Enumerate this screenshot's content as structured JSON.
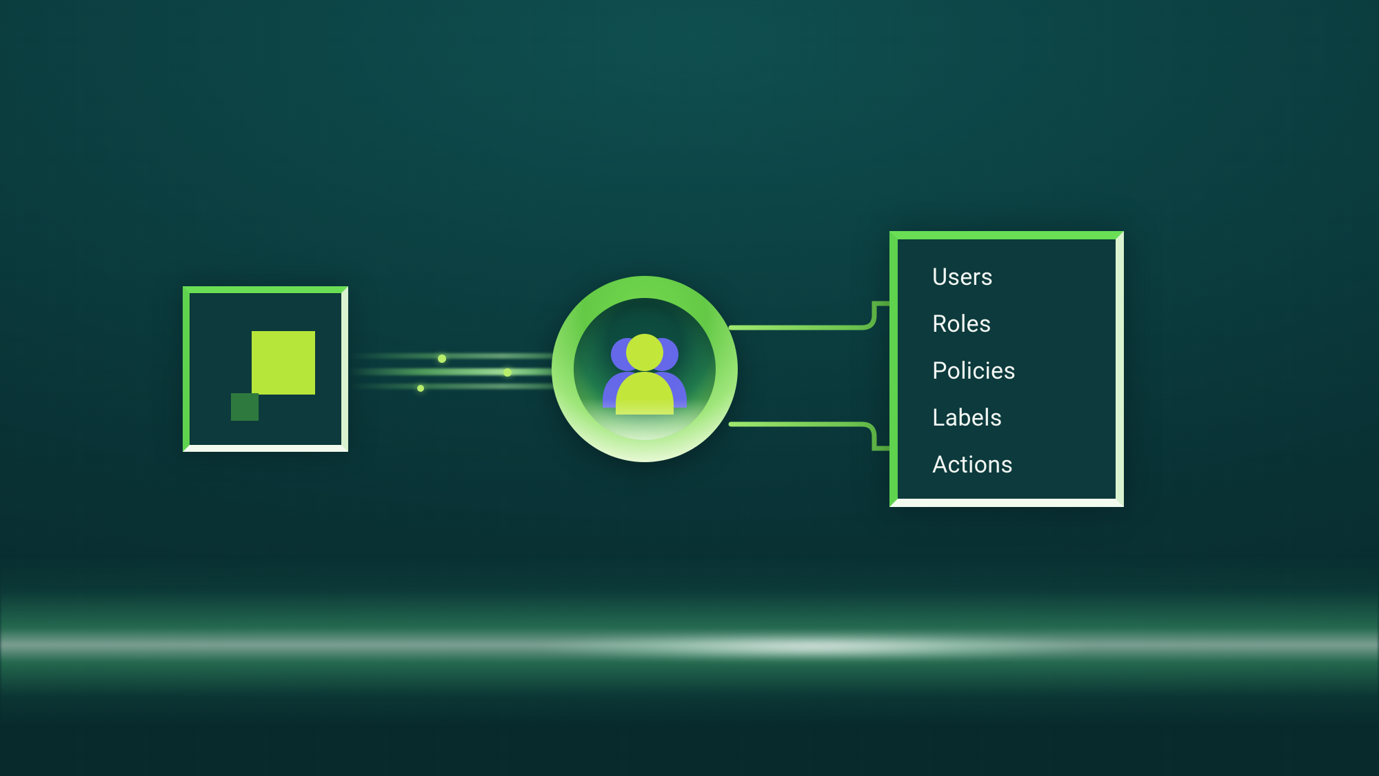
{
  "nodes": {
    "source": {
      "icon_name": "squares-icon"
    },
    "hub": {
      "icon_name": "users-group-icon"
    }
  },
  "list": {
    "items": [
      {
        "label": "Users"
      },
      {
        "label": "Roles"
      },
      {
        "label": "Policies"
      },
      {
        "label": "Labels"
      },
      {
        "label": "Actions"
      }
    ]
  },
  "colors": {
    "bg_dark_teal": "#0d3a3c",
    "accent_green": "#6adf56",
    "accent_lime": "#b7e63a",
    "accent_violet": "#6a6af2"
  }
}
